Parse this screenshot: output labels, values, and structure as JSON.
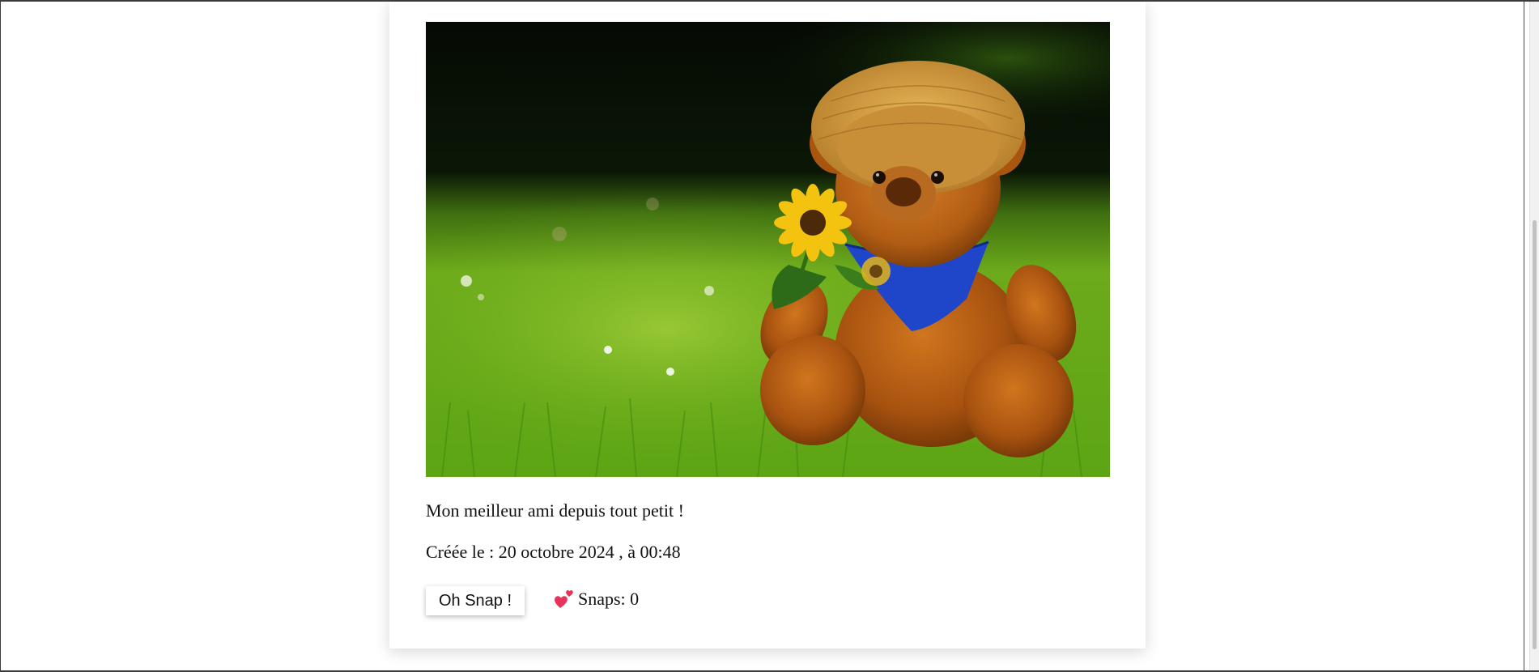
{
  "snap": {
    "image_subject": "teddy bear in straw hat holding sunflower on grass",
    "description": "Mon meilleur ami depuis tout petit !",
    "created": "Créée le : 20 octobre 2024 , à 00:48",
    "button_label": "Oh Snap !",
    "snaps_label": "Snaps: 0"
  },
  "icons": {
    "snaps": "two-hearts-icon",
    "heart_color": "#e8345a"
  }
}
